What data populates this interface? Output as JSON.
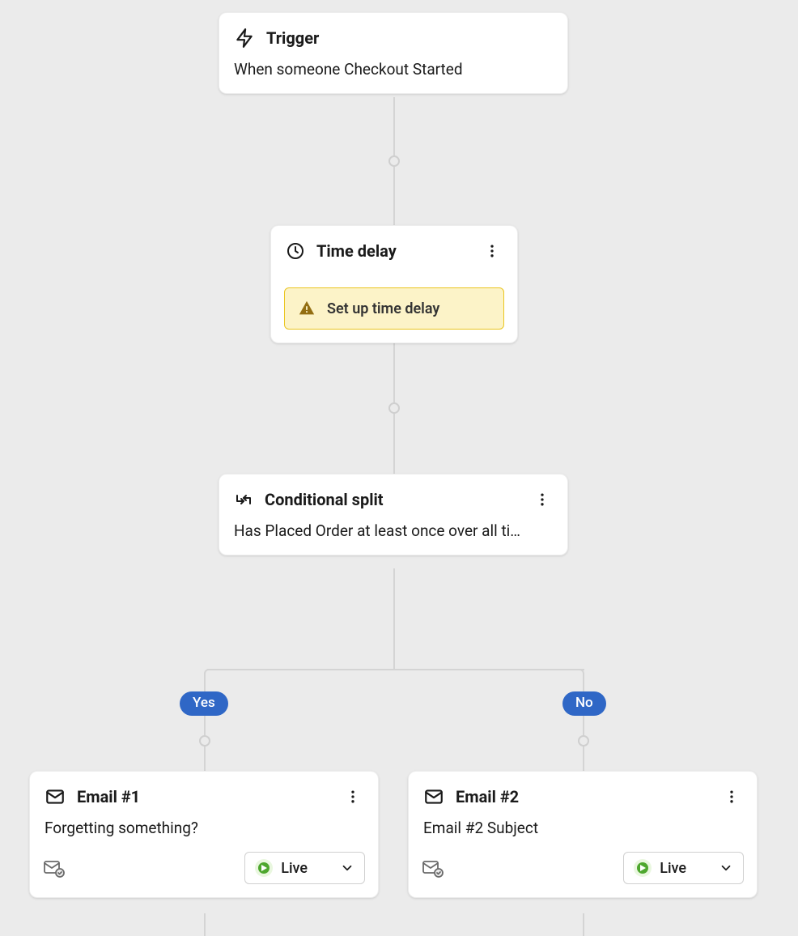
{
  "trigger": {
    "title": "Trigger",
    "description": "When someone Checkout Started"
  },
  "time_delay": {
    "title": "Time delay",
    "warning": "Set up time delay"
  },
  "conditional_split": {
    "title": "Conditional split",
    "description": "Has Placed Order at least once over all ti…"
  },
  "branches": {
    "yes": "Yes",
    "no": "No"
  },
  "email1": {
    "title": "Email #1",
    "subject": "Forgetting something?",
    "status": "Live"
  },
  "email2": {
    "title": "Email #2",
    "subject": "Email #2 Subject",
    "status": "Live"
  }
}
